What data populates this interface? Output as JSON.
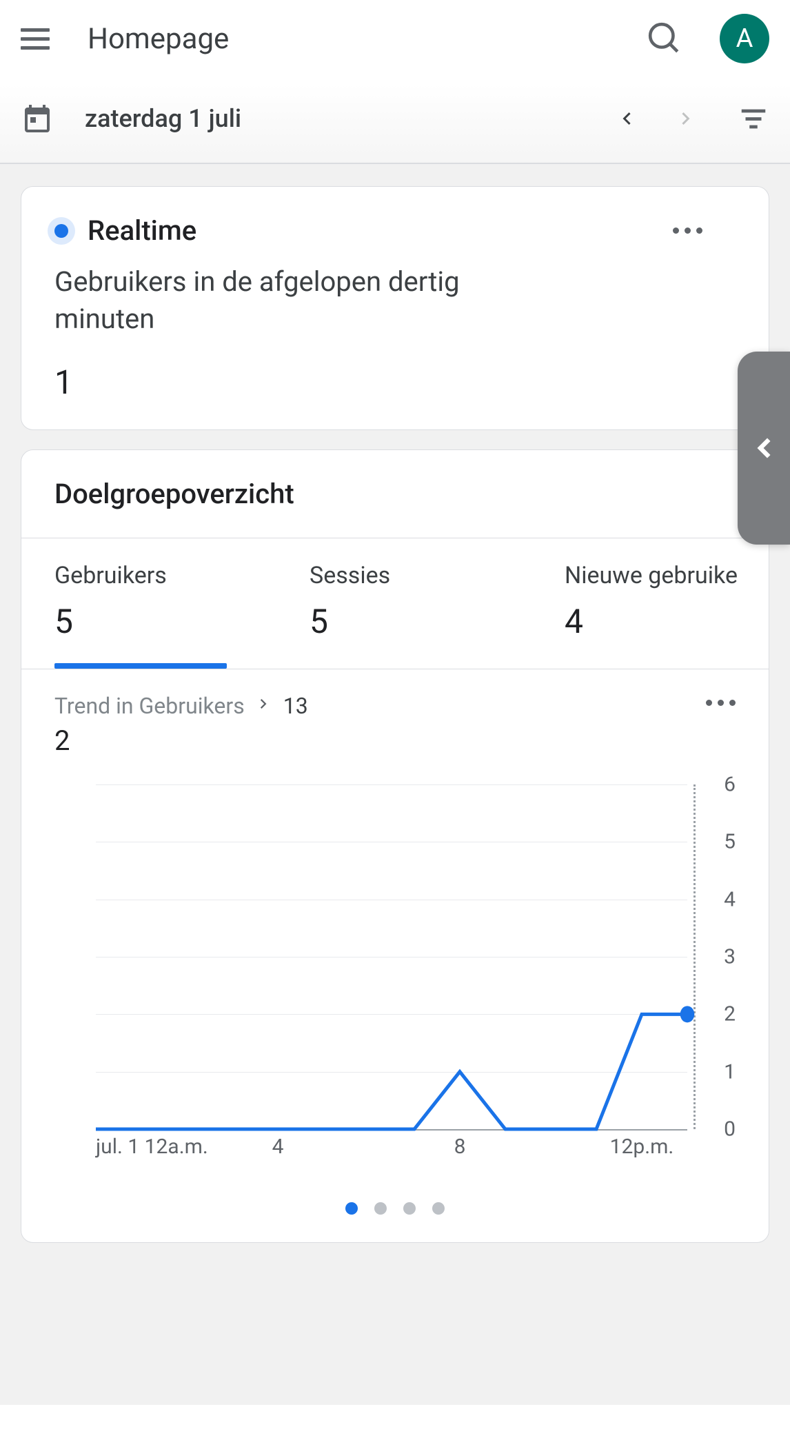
{
  "header": {
    "title": "Homepage",
    "avatar_initial": "A"
  },
  "datebar": {
    "date": "zaterdag 1 juli"
  },
  "realtime": {
    "title": "Realtime",
    "subtitle": "Gebruikers in de afgelopen dertig minuten",
    "value": "1"
  },
  "overview": {
    "title": "Doelgroepoverzicht",
    "tabs": [
      {
        "label": "Gebruikers",
        "value": "5",
        "active": true
      },
      {
        "label": "Sessies",
        "value": "5",
        "active": false
      },
      {
        "label": "Nieuwe gebruike",
        "value": "4",
        "active": false
      }
    ],
    "trend": {
      "label": "Trend in Gebruikers",
      "total": "13",
      "current": "2"
    }
  },
  "chart_data": {
    "type": "line",
    "title": "Trend in Gebruikers",
    "xlabel": "",
    "ylabel": "",
    "ylim": [
      0,
      6
    ],
    "x": [
      0,
      1,
      2,
      3,
      4,
      5,
      6,
      7,
      8,
      9,
      10,
      11,
      12,
      13
    ],
    "x_tick_labels": {
      "0": "jul. 1 12a.m.",
      "4": "4",
      "8": "8",
      "12": "12p.m."
    },
    "values": [
      0,
      0,
      0,
      0,
      0,
      0,
      0,
      0,
      1,
      0,
      0,
      0,
      2,
      2
    ]
  },
  "pager": {
    "count": 4,
    "active": 0
  }
}
